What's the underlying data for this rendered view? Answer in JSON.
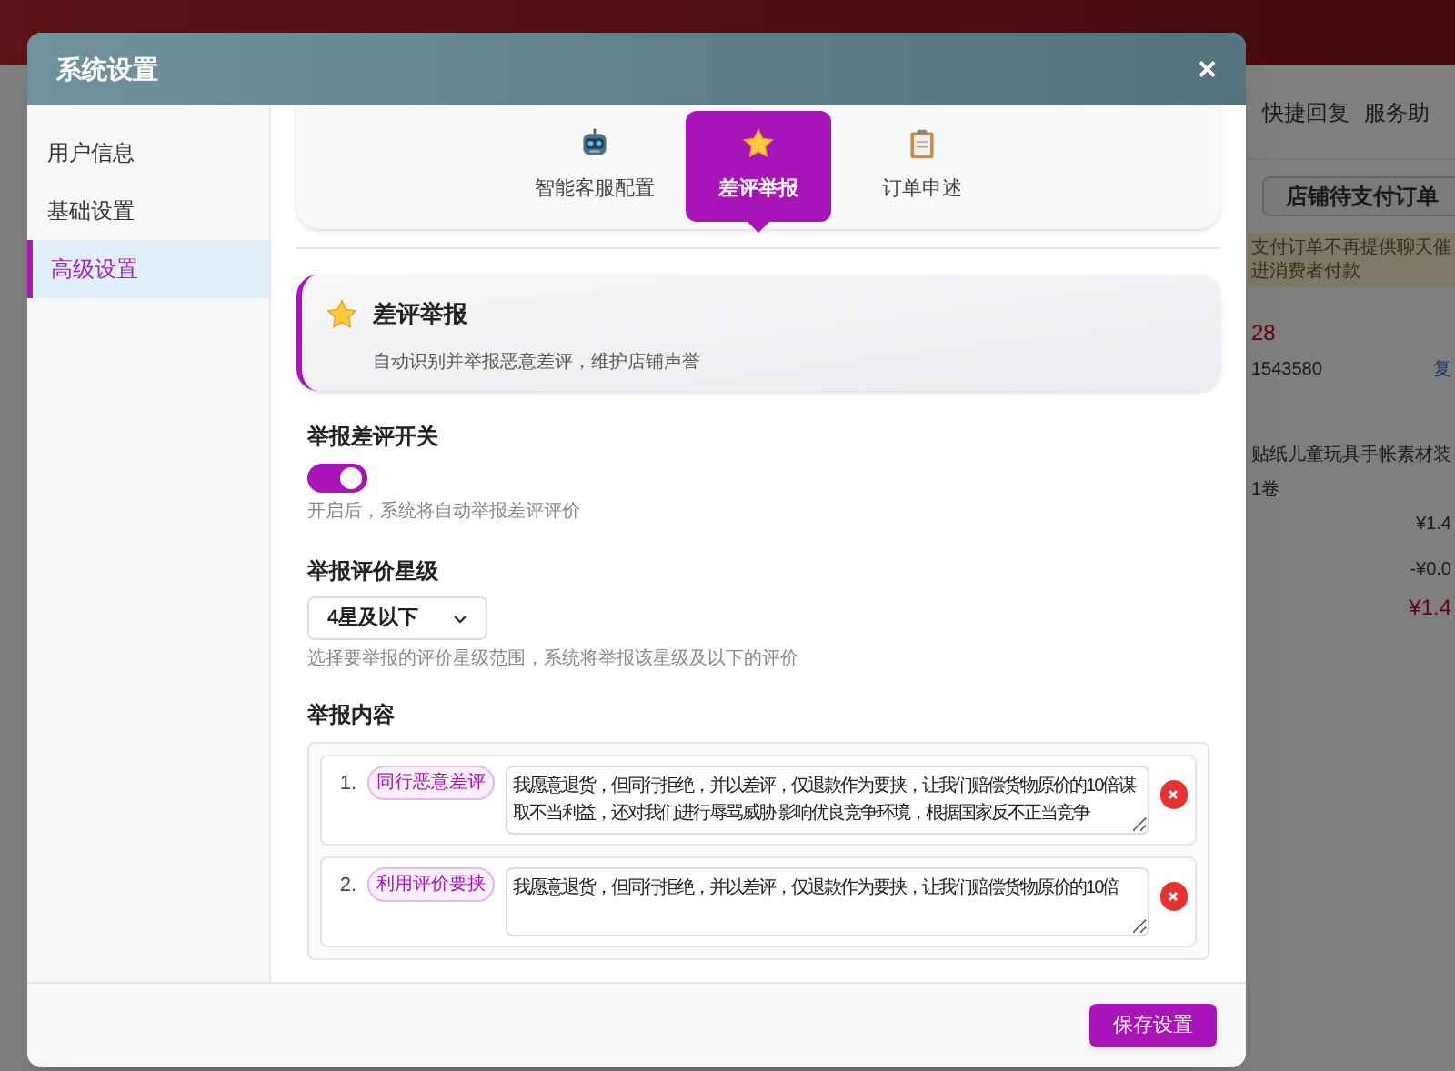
{
  "background_app": {
    "panel_tabs": [
      "快捷回复",
      "服务助"
    ],
    "pending_button": "店铺待支付订单",
    "notice": [
      "支付订单不再提供聊天催",
      "进消费者付款"
    ],
    "order_number": "28",
    "order_id": "1543580",
    "copy_link": "复",
    "product": "贴纸儿童玩具手帐素材装",
    "spec": "1卷",
    "price": "¥1.4",
    "discount": "-¥0.0",
    "total": "¥1.4"
  },
  "dialog": {
    "title": "系统设置",
    "close": "×",
    "sidebar": [
      {
        "label": "用户信息",
        "selected": false
      },
      {
        "label": "基础设置",
        "selected": false
      },
      {
        "label": "高级设置",
        "selected": true
      }
    ],
    "tabs": [
      {
        "kind": "robot",
        "label": "智能客服配置",
        "selected": false
      },
      {
        "kind": "star",
        "label": "差评举报",
        "selected": true
      },
      {
        "kind": "clipboard",
        "label": "订单申述",
        "selected": false
      }
    ],
    "info_card": {
      "title": "差评举报",
      "description": "自动识别并举报恶意差评，维护店铺声誉"
    },
    "switch_section": {
      "label": "举报差评开关",
      "on": true,
      "hint": "开启后，系统将自动举报差评评价"
    },
    "rating_section": {
      "label": "举报评价星级",
      "value": "4星及以下",
      "hint": "选择要举报的评价星级范围，系统将举报该星级及以下的评价"
    },
    "content_section": {
      "label": "举报内容",
      "items": [
        {
          "number": "1.",
          "tag": "同行恶意差评",
          "text": "我愿意退货，但同行拒绝，并以差评，仅退款作为要挟，让我们赔偿货物原价的10倍谋取不当利益，还对我们进行辱骂威胁 影响优良竞争环境，根据国家反不正当竞争"
        },
        {
          "number": "2.",
          "tag": "利用评价要挟",
          "text": "我愿意退货，但同行拒绝，并以差评，仅退款作为要挟，让我们赔偿货物原价的10倍"
        }
      ]
    },
    "save_button": "保存设置"
  }
}
